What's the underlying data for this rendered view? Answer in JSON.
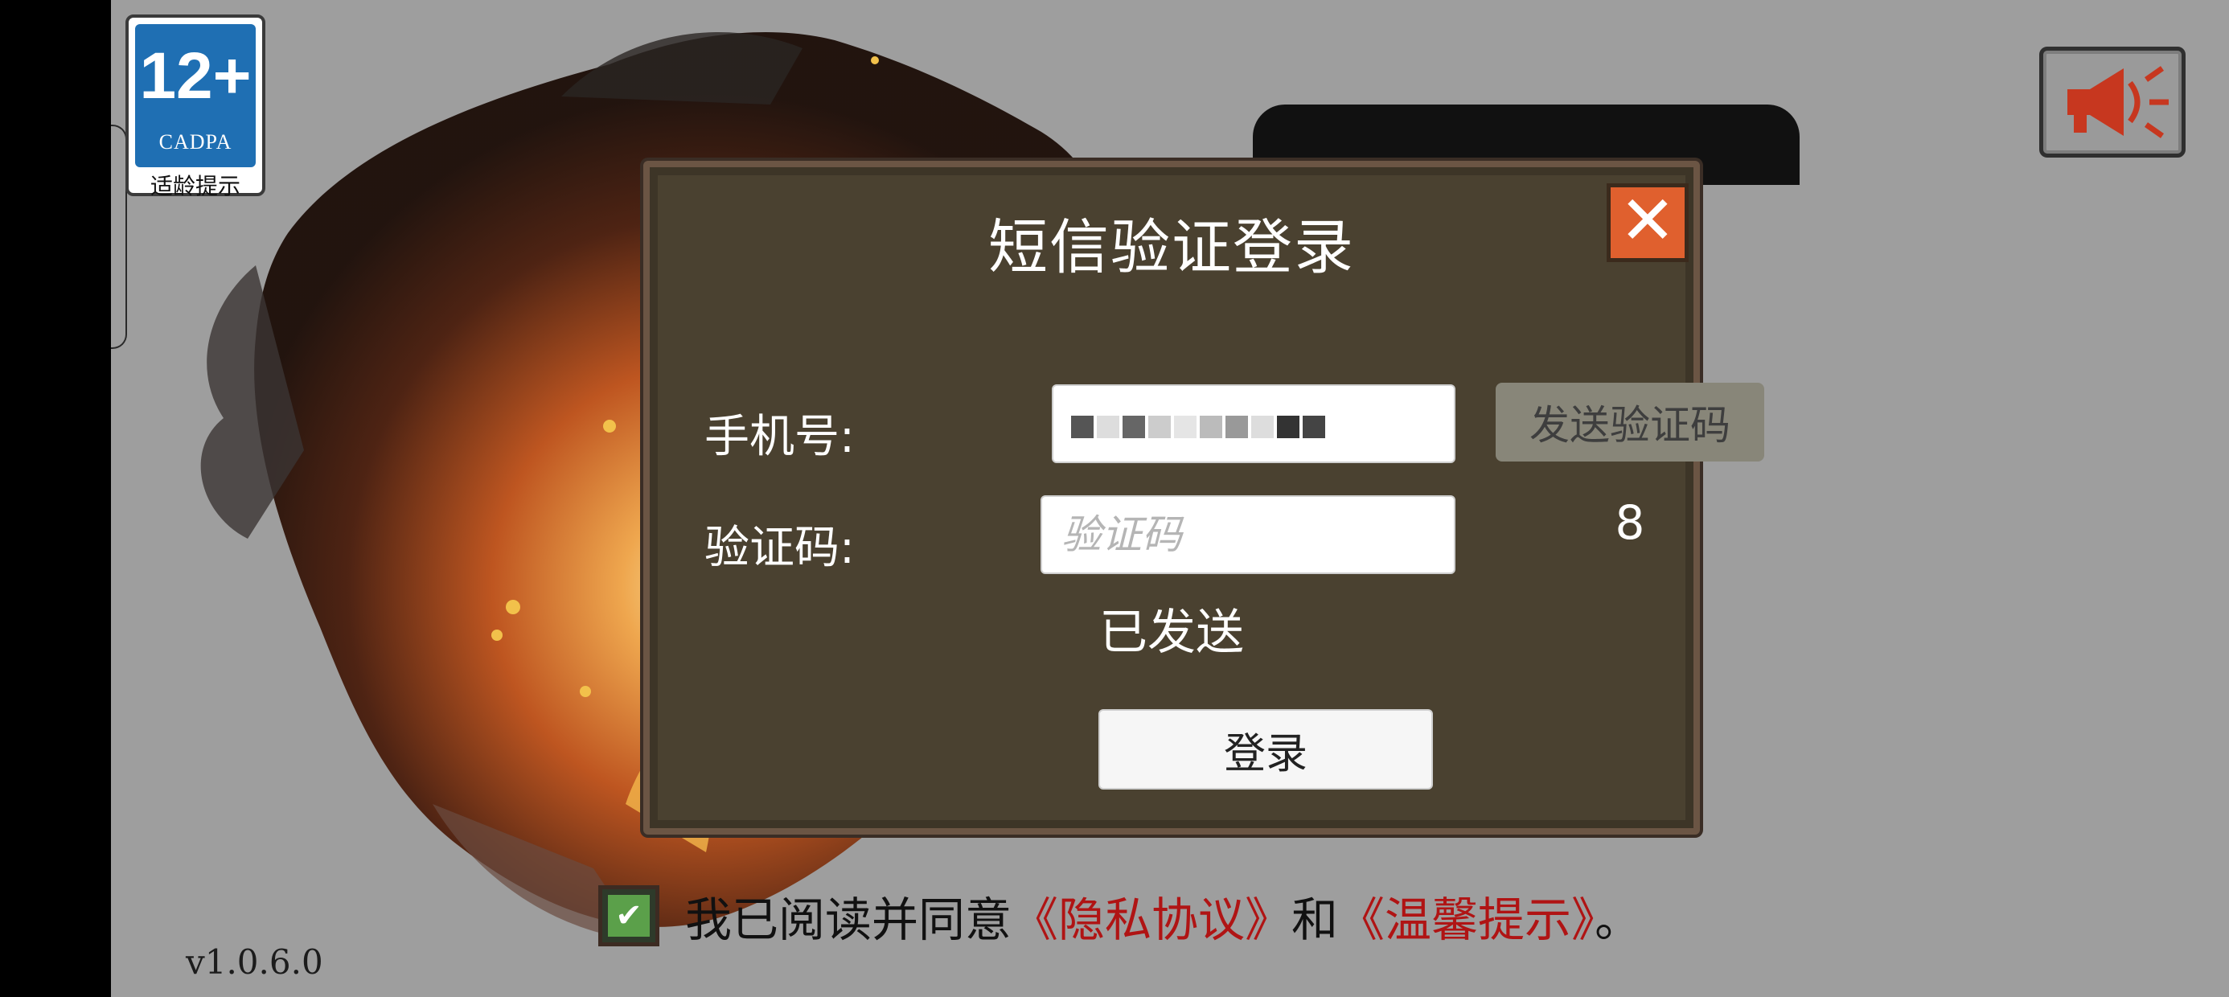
{
  "badge": {
    "age": "12+",
    "org": "CADPA",
    "caption": "适龄提示"
  },
  "dialog": {
    "title": "短信验证登录",
    "close_symbol": "✕",
    "phone_label": "手机号:",
    "phone_value_masked": "",
    "code_label": "验证码:",
    "code_placeholder": "验证码",
    "send_code_label": "发送验证码",
    "countdown": "8",
    "status": "已发送",
    "login_label": "登录"
  },
  "agreement": {
    "checked": true,
    "prefix": "我已阅读并同意",
    "privacy_link": "《隐私协议》",
    "and": "和",
    "tips_link": "《温馨提示》",
    "suffix": "。"
  },
  "version": "v1.0.6.0",
  "colors": {
    "dialog_bg": "#4a4130",
    "close_btn": "#e0602e",
    "link": "#b01414",
    "checkbox": "#5ba04a",
    "badge_blue": "#1f6fb3"
  },
  "icons": {
    "mute": "speaker-muted-icon",
    "close": "close-icon",
    "check": "check-icon"
  }
}
